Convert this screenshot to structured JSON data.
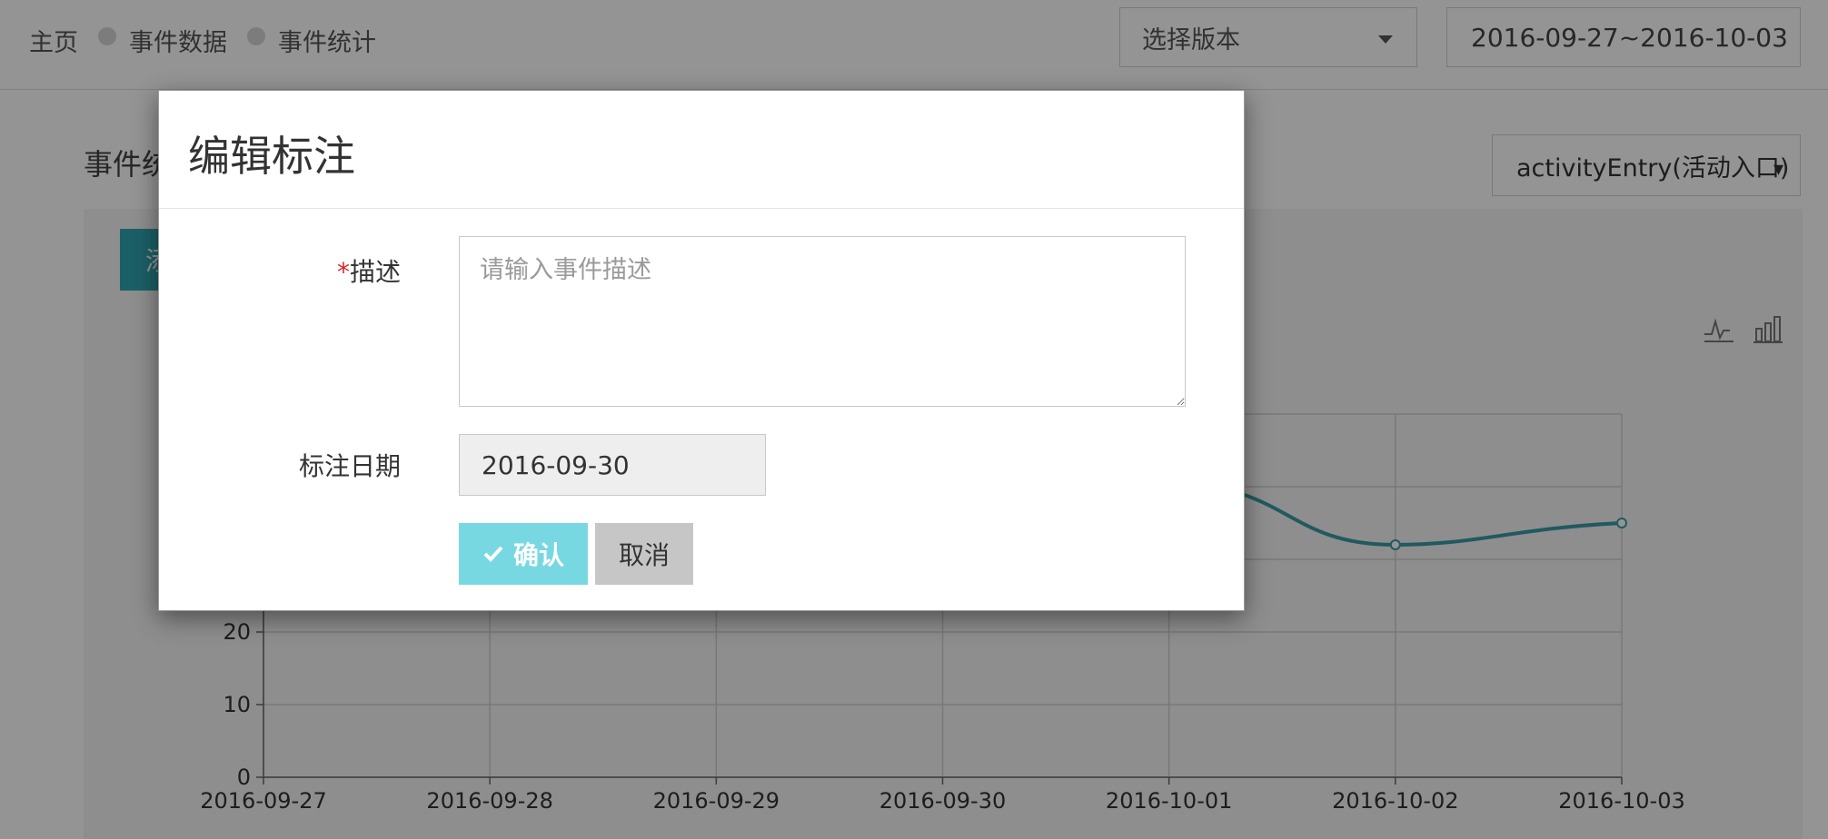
{
  "topbar": {
    "breadcrumbs": [
      "主页",
      "事件数据",
      "事件统计"
    ],
    "version_select": "选择版本",
    "date_range": "2016-09-27~2016-10-03"
  },
  "page": {
    "section_title": "事件统",
    "event_select": "activityEntry(活动入口)",
    "tag_button_label": "添",
    "icons": [
      "line-chart-icon",
      "bar-chart-icon"
    ]
  },
  "chart_data": {
    "type": "line",
    "x": [
      "2016-09-27",
      "2016-09-28",
      "2016-09-29",
      "2016-09-30",
      "2016-10-01",
      "2016-10-02",
      "2016-10-03"
    ],
    "y_ticks": [
      0,
      10,
      20
    ],
    "ylim": [
      0,
      50
    ],
    "series": [
      {
        "color": "#3a9aa6",
        "values": [
          null,
          null,
          null,
          null,
          null,
          32,
          35
        ]
      }
    ],
    "partial_visible_point": {
      "x": "2016-10-01+",
      "value": 39
    },
    "grid": true
  },
  "modal": {
    "title": "编辑标注",
    "desc_label_star": "*",
    "desc_label": "描述",
    "desc_placeholder": "请输入事件描述",
    "date_label": "标注日期",
    "date_value": "2016-09-30",
    "confirm_label": "确认",
    "cancel_label": "取消"
  },
  "colors": {
    "accent": "#30a6b2",
    "confirm_button": "#78d8e2",
    "cancel_button": "#c6c6c6",
    "required_star": "#e0242b",
    "line": "#3a9aa6"
  }
}
